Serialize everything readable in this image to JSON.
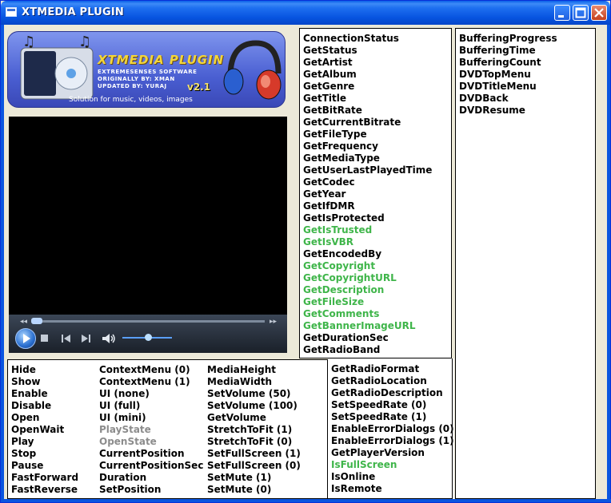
{
  "window": {
    "title": "XTMEDIA PLUGIN"
  },
  "logo": {
    "title": "XTMEDIA PLUGIN",
    "line1": "EXTREMESENSES SOFTWARE",
    "line2": "ORIGINALLY BY: XMAN",
    "line3": "UPDATED BY: YURAJ",
    "version": "v2.1",
    "subtitle": "Solution for music, videos, images"
  },
  "colors": {
    "green": "#3fb54a",
    "gray": "#8c8c8c",
    "black": "#000000"
  },
  "column_mid_top": [
    {
      "label": "ConnectionStatus",
      "color": "black"
    },
    {
      "label": "GetStatus",
      "color": "black"
    },
    {
      "label": "GetArtist",
      "color": "black"
    },
    {
      "label": "GetAlbum",
      "color": "black"
    },
    {
      "label": "GetGenre",
      "color": "black"
    },
    {
      "label": "GetTitle",
      "color": "black"
    },
    {
      "label": "GetBitRate",
      "color": "black"
    },
    {
      "label": "GetCurrentBitrate",
      "color": "black"
    },
    {
      "label": "GetFileType",
      "color": "black"
    },
    {
      "label": "GetFrequency",
      "color": "black"
    },
    {
      "label": "GetMediaType",
      "color": "black"
    },
    {
      "label": "GetUserLastPlayedTime",
      "color": "black"
    },
    {
      "label": "GetCodec",
      "color": "black"
    },
    {
      "label": "GetYear",
      "color": "black"
    },
    {
      "label": "GetIfDMR",
      "color": "black"
    },
    {
      "label": "GetIsProtected",
      "color": "black"
    },
    {
      "label": "GetIsTrusted",
      "color": "green"
    },
    {
      "label": "GetIsVBR",
      "color": "green"
    },
    {
      "label": "GetEncodedBy",
      "color": "black"
    },
    {
      "label": "GetCopyright",
      "color": "green"
    },
    {
      "label": "GetCopyrightURL",
      "color": "green"
    },
    {
      "label": "GetDescription",
      "color": "green"
    },
    {
      "label": "GetFileSize",
      "color": "green"
    },
    {
      "label": "GetComments",
      "color": "green"
    },
    {
      "label": "GetBannerImageURL",
      "color": "green"
    },
    {
      "label": "GetDurationSec",
      "color": "black"
    },
    {
      "label": "GetRadioBand",
      "color": "black"
    }
  ],
  "column_mid_bottom": [
    {
      "label": "GetRadioFormat",
      "color": "black"
    },
    {
      "label": "GetRadioLocation",
      "color": "black"
    },
    {
      "label": "GetRadioDescription",
      "color": "black"
    },
    {
      "label": "SetSpeedRate (0)",
      "color": "black"
    },
    {
      "label": "SetSpeedRate (1)",
      "color": "black"
    },
    {
      "label": "EnableErrorDialogs (0)",
      "color": "black"
    },
    {
      "label": "EnableErrorDialogs (1)",
      "color": "black"
    },
    {
      "label": "GetPlayerVersion",
      "color": "black"
    },
    {
      "label": "IsFullScreen",
      "color": "green"
    },
    {
      "label": "IsOnline",
      "color": "black"
    },
    {
      "label": "IsRemote",
      "color": "black"
    }
  ],
  "column_right": [
    {
      "label": "BufferingProgress",
      "color": "black"
    },
    {
      "label": "BufferingTime",
      "color": "black"
    },
    {
      "label": "BufferingCount",
      "color": "black"
    },
    {
      "label": "DVDTopMenu",
      "color": "black"
    },
    {
      "label": "DVDTitleMenu",
      "color": "black"
    },
    {
      "label": "DVDBack",
      "color": "black"
    },
    {
      "label": "DVDResume",
      "color": "black"
    }
  ],
  "bottom_col1": [
    {
      "label": "Hide",
      "color": "black"
    },
    {
      "label": "Show",
      "color": "black"
    },
    {
      "label": "Enable",
      "color": "black"
    },
    {
      "label": "Disable",
      "color": "black"
    },
    {
      "label": "Open",
      "color": "black"
    },
    {
      "label": "OpenWait",
      "color": "black"
    },
    {
      "label": "Play",
      "color": "black"
    },
    {
      "label": "Stop",
      "color": "black"
    },
    {
      "label": "Pause",
      "color": "black"
    },
    {
      "label": "FastForward",
      "color": "black"
    },
    {
      "label": "FastReverse",
      "color": "black"
    }
  ],
  "bottom_col2": [
    {
      "label": "ContextMenu (0)",
      "color": "black"
    },
    {
      "label": "ContextMenu (1)",
      "color": "black"
    },
    {
      "label": "UI (none)",
      "color": "black"
    },
    {
      "label": "UI (full)",
      "color": "black"
    },
    {
      "label": "UI (mini)",
      "color": "black"
    },
    {
      "label": "PlayState",
      "color": "gray"
    },
    {
      "label": "OpenState",
      "color": "gray"
    },
    {
      "label": "CurrentPosition",
      "color": "black"
    },
    {
      "label": "CurrentPositionSec",
      "color": "black"
    },
    {
      "label": "Duration",
      "color": "black"
    },
    {
      "label": "SetPosition",
      "color": "black"
    }
  ],
  "bottom_col3": [
    {
      "label": "MediaHeight",
      "color": "black"
    },
    {
      "label": "MediaWidth",
      "color": "black"
    },
    {
      "label": "SetVolume (50)",
      "color": "black"
    },
    {
      "label": "SetVolume (100)",
      "color": "black"
    },
    {
      "label": "GetVolume",
      "color": "black"
    },
    {
      "label": "StretchToFit (1)",
      "color": "black"
    },
    {
      "label": "StretchToFit (0)",
      "color": "black"
    },
    {
      "label": "SetFullScreen (1)",
      "color": "black"
    },
    {
      "label": "SetFullScreen (0)",
      "color": "black"
    },
    {
      "label": "SetMute (1)",
      "color": "black"
    },
    {
      "label": "SetMute (0)",
      "color": "black"
    }
  ]
}
